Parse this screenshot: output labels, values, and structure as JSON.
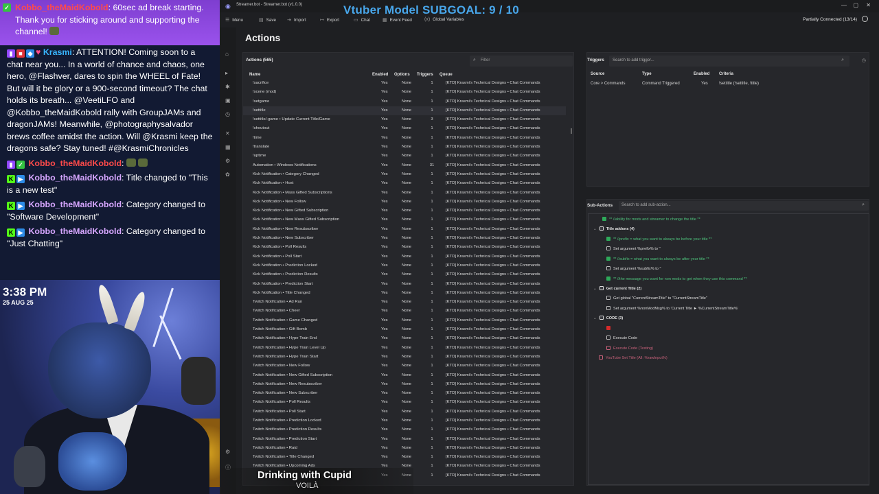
{
  "chat": {
    "highlight": {
      "user": "Kobbo_theMaidKobold",
      "text": ": 60sec ad break starting. Thank you for sticking around and supporting the channel! "
    },
    "messages": [
      {
        "user": "Krasmi",
        "text": ": ATTENTION! Coming soon to a chat near you... In a world of chance and chaos, one hero, @Flashver, dares to spin the WHEEL of Fate! But will it be glory or a 900-second timeout? The chat holds its breath... @VeetiLFO and @Kobbo_theMaidKobold rally with GroupJAMs and dragonJAMs! Meanwhile, @photographysalvador brews coffee amidst the action. Will @Krasmi keep the dragons safe? Stay tuned! #@KrasmiChronicles"
      },
      {
        "user": "Kobbo_theMaidKobold",
        "text": ":"
      },
      {
        "user": "Kobbo_theMaidKobold",
        "text": ": Title changed to \"This is a new test\""
      },
      {
        "user": "Kobbo_theMaidKobold",
        "text": ": Category changed to \"Software Development\""
      },
      {
        "user": "Kobbo_theMaidKobold",
        "text": ": Category changed to \"Just Chatting\""
      }
    ]
  },
  "clock": {
    "time": "3:38 PM",
    "date": "25 AUG 25"
  },
  "app": {
    "title": "Streamer.bot - Streamer.bot (v1.0.0)",
    "overlay_goal": "Vtuber Model SUBGOAL: 9 / 10",
    "menu": [
      "Menu",
      "Save",
      "Import",
      "Export",
      "Chat",
      "Event Feed",
      "Global Variables"
    ],
    "connection": "Partially Connected (13/14)",
    "page_title": "Actions"
  },
  "actions": {
    "header": "Actions (565)",
    "filter_placeholder": "Filter",
    "columns": [
      "Name",
      "Enabled",
      "Options",
      "Triggers",
      "Queue"
    ],
    "rows": [
      [
        "!sacrifice",
        "Yes",
        "None",
        "1",
        "[KTD] Krasmi's Technical Designs • Chat Commands"
      ],
      [
        "!scene (mod)",
        "Yes",
        "None",
        "1",
        "[KTD] Krasmi's Technical Designs • Chat Commands"
      ],
      [
        "!setgame",
        "Yes",
        "None",
        "1",
        "[KTD] Krasmi's Technical Designs • Chat Commands"
      ],
      [
        "!settitle",
        "Yes",
        "None",
        "1",
        "[KTD] Krasmi's Technical Designs • Chat Commands"
      ],
      [
        "!settitle/-game • Update Current Title/Game",
        "Yes",
        "None",
        "3",
        "[KTD] Krasmi's Technical Designs • Chat Commands"
      ],
      [
        "!shoutout",
        "Yes",
        "None",
        "1",
        "[KTD] Krasmi's Technical Designs • Chat Commands"
      ],
      [
        "!time",
        "Yes",
        "None",
        "1",
        "[KTD] Krasmi's Technical Designs • Chat Commands"
      ],
      [
        "!translate",
        "Yes",
        "None",
        "1",
        "[KTD] Krasmi's Technical Designs • Chat Commands"
      ],
      [
        "!uptime",
        "Yes",
        "None",
        "1",
        "[KTD] Krasmi's Technical Designs • Chat Commands"
      ],
      [
        "Automation • Windows Notifications",
        "Yes",
        "None",
        "31",
        "[KTD] Krasmi's Technical Designs • Chat Commands"
      ],
      [
        "Kick Notification • Category Changed",
        "Yes",
        "None",
        "1",
        "[KTD] Krasmi's Technical Designs • Chat Commands"
      ],
      [
        "Kick Notification • Host",
        "Yes",
        "None",
        "1",
        "[KTD] Krasmi's Technical Designs • Chat Commands"
      ],
      [
        "Kick Notification • Mass Gifted Subscriptions",
        "Yes",
        "None",
        "1",
        "[KTD] Krasmi's Technical Designs • Chat Commands"
      ],
      [
        "Kick Notification • New Follow",
        "Yes",
        "None",
        "1",
        "[KTD] Krasmi's Technical Designs • Chat Commands"
      ],
      [
        "Kick Notification • New Gifted Subscription",
        "Yes",
        "None",
        "1",
        "[KTD] Krasmi's Technical Designs • Chat Commands"
      ],
      [
        "Kick Notification • New Mass Gifted Subscription",
        "Yes",
        "None",
        "1",
        "[KTD] Krasmi's Technical Designs • Chat Commands"
      ],
      [
        "Kick Notification • New Resubscriber",
        "Yes",
        "None",
        "1",
        "[KTD] Krasmi's Technical Designs • Chat Commands"
      ],
      [
        "Kick Notification • New Subscriber",
        "Yes",
        "None",
        "1",
        "[KTD] Krasmi's Technical Designs • Chat Commands"
      ],
      [
        "Kick Notification • Poll Results",
        "Yes",
        "None",
        "1",
        "[KTD] Krasmi's Technical Designs • Chat Commands"
      ],
      [
        "Kick Notification • Poll Start",
        "Yes",
        "None",
        "1",
        "[KTD] Krasmi's Technical Designs • Chat Commands"
      ],
      [
        "Kick Notification • Prediction Locked",
        "Yes",
        "None",
        "1",
        "[KTD] Krasmi's Technical Designs • Chat Commands"
      ],
      [
        "Kick Notification • Prediction Results",
        "Yes",
        "None",
        "1",
        "[KTD] Krasmi's Technical Designs • Chat Commands"
      ],
      [
        "Kick Notification • Prediction Start",
        "Yes",
        "None",
        "1",
        "[KTD] Krasmi's Technical Designs • Chat Commands"
      ],
      [
        "Kick Notification • Title Changed",
        "Yes",
        "None",
        "1",
        "[KTD] Krasmi's Technical Designs • Chat Commands"
      ],
      [
        "Twitch Notification • Ad Run",
        "Yes",
        "None",
        "1",
        "[KTD] Krasmi's Technical Designs • Chat Commands"
      ],
      [
        "Twitch Notification • Cheer",
        "Yes",
        "None",
        "1",
        "[KTD] Krasmi's Technical Designs • Chat Commands"
      ],
      [
        "Twitch Notification • Game Changed",
        "Yes",
        "None",
        "1",
        "[KTD] Krasmi's Technical Designs • Chat Commands"
      ],
      [
        "Twitch Notification • Gift Bomb",
        "Yes",
        "None",
        "1",
        "[KTD] Krasmi's Technical Designs • Chat Commands"
      ],
      [
        "Twitch Notification • Hype Train End",
        "Yes",
        "None",
        "1",
        "[KTD] Krasmi's Technical Designs • Chat Commands"
      ],
      [
        "Twitch Notification • Hype Train Level Up",
        "Yes",
        "None",
        "1",
        "[KTD] Krasmi's Technical Designs • Chat Commands"
      ],
      [
        "Twitch Notification • Hype Train Start",
        "Yes",
        "None",
        "1",
        "[KTD] Krasmi's Technical Designs • Chat Commands"
      ],
      [
        "Twitch Notification • New Follow",
        "Yes",
        "None",
        "1",
        "[KTD] Krasmi's Technical Designs • Chat Commands"
      ],
      [
        "Twitch Notification • New Gifted Subscription",
        "Yes",
        "None",
        "1",
        "[KTD] Krasmi's Technical Designs • Chat Commands"
      ],
      [
        "Twitch Notification • New Resubscriber",
        "Yes",
        "None",
        "1",
        "[KTD] Krasmi's Technical Designs • Chat Commands"
      ],
      [
        "Twitch Notification • New Subscriber",
        "Yes",
        "None",
        "1",
        "[KTD] Krasmi's Technical Designs • Chat Commands"
      ],
      [
        "Twitch Notification • Poll Results",
        "Yes",
        "None",
        "1",
        "[KTD] Krasmi's Technical Designs • Chat Commands"
      ],
      [
        "Twitch Notification • Poll Start",
        "Yes",
        "None",
        "1",
        "[KTD] Krasmi's Technical Designs • Chat Commands"
      ],
      [
        "Twitch Notification • Prediction Locked",
        "Yes",
        "None",
        "1",
        "[KTD] Krasmi's Technical Designs • Chat Commands"
      ],
      [
        "Twitch Notification • Prediction Results",
        "Yes",
        "None",
        "1",
        "[KTD] Krasmi's Technical Designs • Chat Commands"
      ],
      [
        "Twitch Notification • Prediction Start",
        "Yes",
        "None",
        "1",
        "[KTD] Krasmi's Technical Designs • Chat Commands"
      ],
      [
        "Twitch Notification • Raid",
        "Yes",
        "None",
        "1",
        "[KTD] Krasmi's Technical Designs • Chat Commands"
      ],
      [
        "Twitch Notification • Title Changed",
        "Yes",
        "None",
        "1",
        "[KTD] Krasmi's Technical Designs • Chat Commands"
      ],
      [
        "Twitch Notification • Upcoming Ads",
        "Yes",
        "None",
        "1",
        "[KTD] Krasmi's Technical Designs • Chat Commands"
      ],
      [
        "",
        "Yes",
        "None",
        "1",
        "[KTD] Krasmi's Technical Designs • Chat Commands"
      ]
    ]
  },
  "triggers": {
    "header": "Triggers",
    "search_placeholder": "Search to add trigger...",
    "columns": [
      "Source",
      "Type",
      "Enabled",
      "Criteria"
    ],
    "row": [
      "Core > Commands",
      "Command Triggered",
      "Yes",
      "!settitle (!settitle, !title)"
    ]
  },
  "subactions": {
    "header": "Sub-Actions",
    "search_placeholder": "Search to add sub-action...",
    "items": [
      {
        "kind": "green",
        "text": "** //ability for mods and streamer to change the title **"
      },
      {
        "kind": "group",
        "text": "Title addons (4)"
      },
      {
        "kind": "green",
        "text": "** //prefix = what you want to always be before your title **"
      },
      {
        "kind": "white",
        "text": "Set argument %prefix% to ''"
      },
      {
        "kind": "green",
        "text": "** //subfix = what you want to always be after your title **"
      },
      {
        "kind": "white",
        "text": "Set argument %subfix% to ''"
      },
      {
        "kind": "green",
        "text": "** //the message you want for non mods to get when they use this command **"
      },
      {
        "kind": "group",
        "text": "Get current Title (2)"
      },
      {
        "kind": "white",
        "text": "Get global \"CurrentStreamTitle\" to \"CurrentStreamTitle\""
      },
      {
        "kind": "white",
        "text": "Set argument %nonModMsg% to 'Current Title ► %CurrentStreamTitle%'"
      },
      {
        "kind": "group",
        "text": "CODE (3)"
      },
      {
        "kind": "red",
        "text": ""
      },
      {
        "kind": "white",
        "text": "Execute Code"
      },
      {
        "kind": "pink",
        "text": "Execute Code (Testing)"
      },
      {
        "kind": "pink",
        "text": "YouTube Set Title (All: %rawInput%)"
      }
    ]
  },
  "now_playing": {
    "title": "Drinking with Cupid",
    "artist": "VOILÀ"
  },
  "colors": {
    "accent": "#48a6ea",
    "twitch": "#9146ff",
    "kick": "#53fc18",
    "highlight": "#9a52ec"
  }
}
